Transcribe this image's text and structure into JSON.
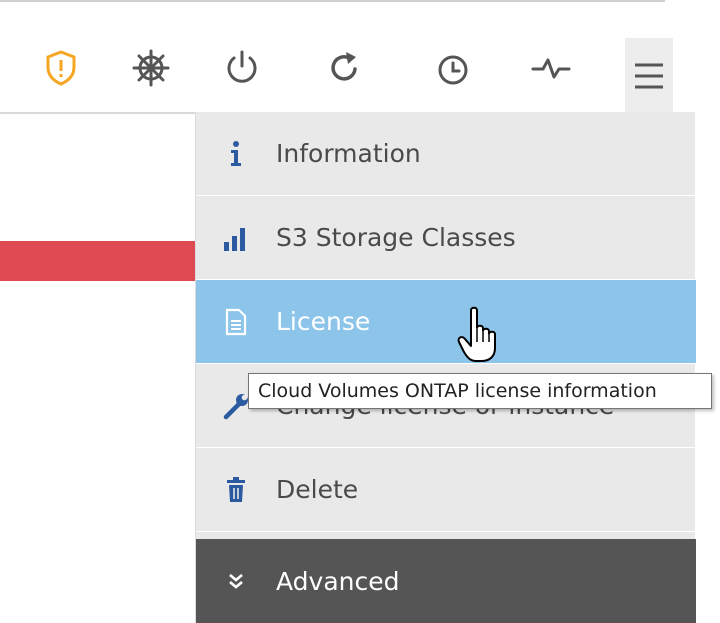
{
  "toolbar": {
    "icons": [
      {
        "name": "alert-shield-icon",
        "color": "#f5a623"
      },
      {
        "name": "helm-icon",
        "color": "#555555"
      },
      {
        "name": "power-icon",
        "color": "#555555"
      },
      {
        "name": "refresh-icon",
        "color": "#555555"
      },
      {
        "name": "clock-icon",
        "color": "#555555"
      },
      {
        "name": "activity-icon",
        "color": "#555555"
      },
      {
        "name": "hamburger-menu-icon",
        "color": "#555555"
      }
    ]
  },
  "status_bar_color": "#e04b53",
  "menu": {
    "items": [
      {
        "label": "Information",
        "icon": "info-icon",
        "icon_color": "#2c5aa0"
      },
      {
        "label": "S3 Storage Classes",
        "icon": "bar-chart-icon",
        "icon_color": "#2c5aa0"
      },
      {
        "label": "License",
        "icon": "document-icon",
        "icon_color": "#ffffff",
        "selected": true
      },
      {
        "label": "Change license or instance",
        "icon": "wrench-icon",
        "icon_color": "#2c5aa0"
      },
      {
        "label": "Delete",
        "icon": "trash-icon",
        "icon_color": "#2c5aa0"
      },
      {
        "label": "Advanced",
        "icon": "double-chevron-down-icon",
        "icon_color": "#ffffff"
      }
    ],
    "selected_color": "#8cc4ea",
    "advanced_bg": "#555555"
  },
  "tooltip": {
    "text": "Cloud Volumes ONTAP license information"
  }
}
